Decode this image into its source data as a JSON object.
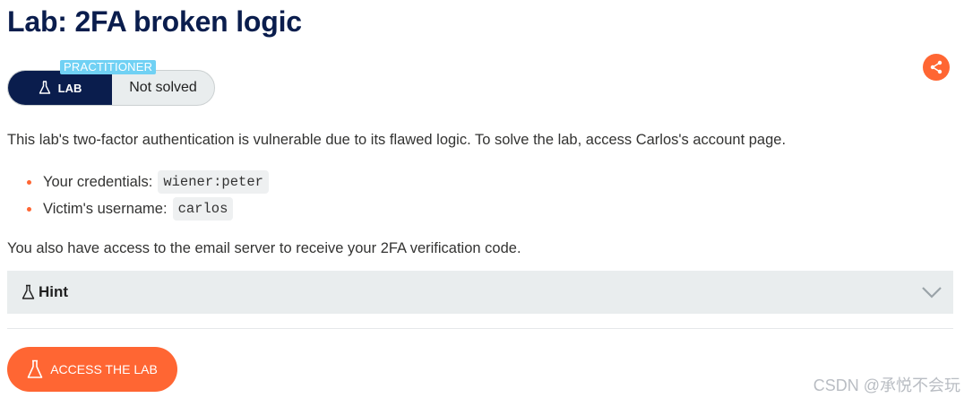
{
  "title": "Lab: 2FA broken logic",
  "badge": {
    "level": "PRACTITIONER",
    "type_label": "LAB",
    "status": "Not solved"
  },
  "description": "This lab's two-factor authentication is vulnerable due to its flawed logic. To solve the lab, access Carlos's account page.",
  "credentials": [
    {
      "label": "Your credentials:",
      "value": "wiener:peter"
    },
    {
      "label": "Victim's username:",
      "value": "carlos"
    }
  ],
  "email_note": "You also have access to the email server to receive your 2FA verification code.",
  "hint": {
    "label": "Hint"
  },
  "access_button": {
    "label": "ACCESS THE LAB"
  },
  "watermark": "CSDN @承悦不会玩",
  "icons": {
    "share": "share-icon",
    "flask": "flask-icon",
    "chevron": "chevron-down-icon"
  },
  "colors": {
    "navy": "#0a1d4d",
    "orange": "#ff6633",
    "level_blue": "#70d1f4",
    "panel_gray": "#e9edee"
  }
}
